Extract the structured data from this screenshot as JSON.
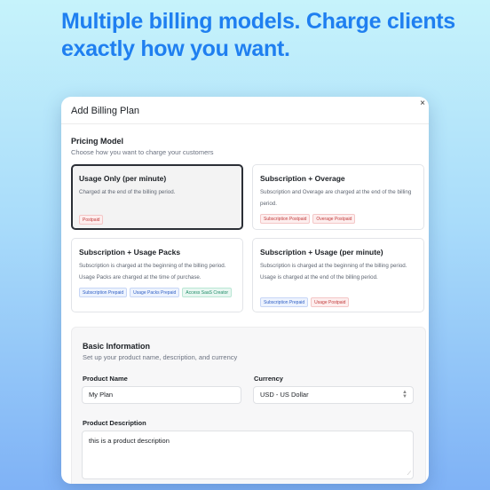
{
  "headline": "Multiple billing models. Charge clients exactly how you want.",
  "modal": {
    "title": "Add Billing Plan",
    "close_icon": "close-icon",
    "close_glyph": "×"
  },
  "pricing": {
    "title": "Pricing Model",
    "subtitle": "Choose how you want to charge your customers",
    "options": [
      {
        "title": "Usage Only (per minute)",
        "description": "Charged at the end of the billing period.",
        "selected": true,
        "badges": [
          {
            "label": "Postpaid",
            "color": "red"
          }
        ]
      },
      {
        "title": "Subscription + Overage",
        "description": "Subscription and Overage are charged at the end of the billing period.",
        "selected": false,
        "badges": [
          {
            "label": "Subscription Postpaid",
            "color": "red"
          },
          {
            "label": "Overage Postpaid",
            "color": "red"
          }
        ]
      },
      {
        "title": "Subscription + Usage Packs",
        "description": "Subscription is charged at the beginning of the billing period. Usage Packs are charged at the time of purchase.",
        "selected": false,
        "badges": [
          {
            "label": "Subscription Prepaid",
            "color": "blue"
          },
          {
            "label": "Usage Packs Prepaid",
            "color": "blue"
          },
          {
            "label": "Access SaaS Creator",
            "color": "green"
          }
        ]
      },
      {
        "title": "Subscription + Usage (per minute)",
        "description": "Subscription is charged at the beginning of the billing period. Usage is charged at the end of the billing period.",
        "selected": false,
        "badges": [
          {
            "label": "Subscription Prepaid",
            "color": "blue"
          },
          {
            "label": "Usage Postpaid",
            "color": "red"
          }
        ]
      }
    ]
  },
  "basic_info": {
    "title": "Basic Information",
    "subtitle": "Set up your product name, description, and currency",
    "product_name_label": "Product Name",
    "product_name_value": "My Plan",
    "currency_label": "Currency",
    "currency_value": "USD - US Dollar",
    "description_label": "Product Description",
    "description_value": "this is a product description"
  },
  "colors": {
    "headline": "#1f7ff0",
    "badge_red": "#c23b3b",
    "badge_blue": "#2f5fc4",
    "badge_green": "#1f8c68"
  }
}
